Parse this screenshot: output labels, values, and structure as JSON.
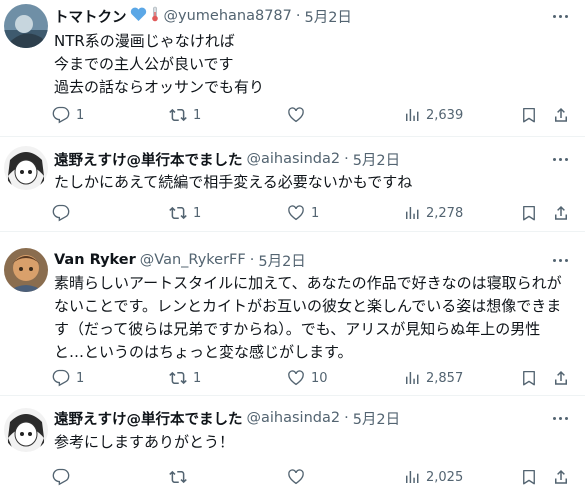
{
  "posts": [
    {
      "name": "トマトクン",
      "handle": "@yumehana8787",
      "date": "5月2日",
      "lines": [
        "NTR系の漫画じゃなければ",
        "今までの主人公が良いです",
        "過去の話ならオッサンでも有り"
      ],
      "replies": "1",
      "reposts": "1",
      "likes": "",
      "views": "2,639"
    },
    {
      "name": "遠野えすけ@単行本でました",
      "handle": "@aihasinda2",
      "date": "5月2日",
      "lines": [
        "たしかにあえて続編で相手変える必要ないかもですね"
      ],
      "replies": "",
      "reposts": "1",
      "likes": "1",
      "views": "2,278"
    },
    {
      "name": "Van Ryker",
      "handle": "@Van_RykerFF",
      "date": "5月2日",
      "lines": [
        "素晴らしいアートスタイルに加えて、あなたの作品で好きなのは寝取られが",
        "ないことです。レンとカイトがお互いの彼女と楽しんでいる姿は想像できま",
        "す（だって彼らは兄弟ですからね）。でも、アリスが見知らぬ年上の男性",
        "と…というのはちょっと変な感じがします。"
      ],
      "replies": "1",
      "reposts": "1",
      "likes": "10",
      "views": "2,857"
    },
    {
      "name": "遠野えすけ@単行本でました",
      "handle": "@aihasinda2",
      "date": "5月2日",
      "lines": [
        "参考にしますありがとう！"
      ],
      "replies": "",
      "reposts": "",
      "likes": "",
      "views": "2,025"
    }
  ],
  "dot_separator": "·",
  "colors": {
    "text": "#0f1419",
    "muted": "#536471",
    "separator": "#eff3f4",
    "badge_heart": "#5ba7e6"
  }
}
